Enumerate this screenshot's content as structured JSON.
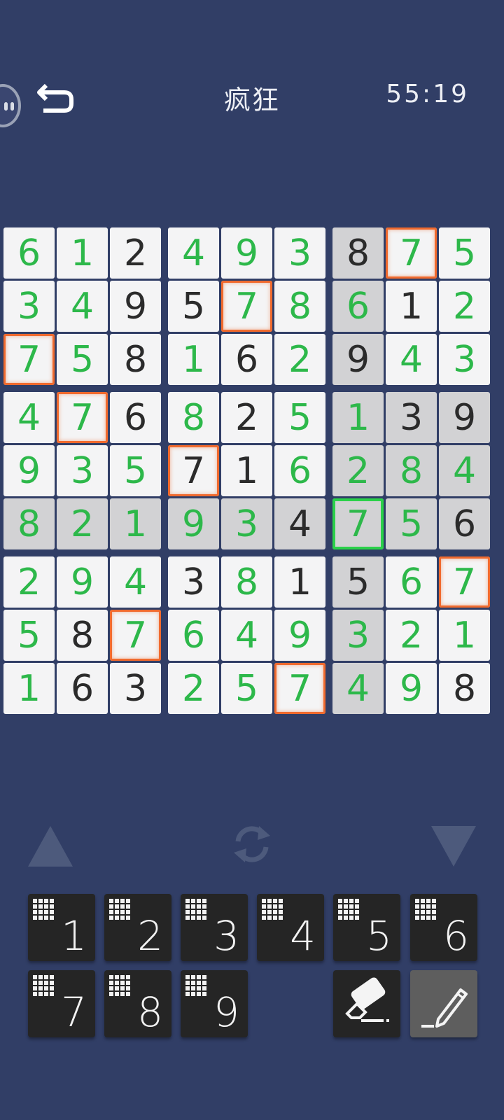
{
  "header": {
    "title": "疯狂",
    "timer": "55:19"
  },
  "board": {
    "rows": [
      [
        "6",
        "1",
        "2",
        "4",
        "9",
        "3",
        "8",
        "7",
        "5"
      ],
      [
        "3",
        "4",
        "9",
        "5",
        "7",
        "8",
        "6",
        "1",
        "2"
      ],
      [
        "7",
        "5",
        "8",
        "1",
        "6",
        "2",
        "9",
        "4",
        "3"
      ],
      [
        "4",
        "7",
        "6",
        "8",
        "2",
        "5",
        "1",
        "3",
        "9"
      ],
      [
        "9",
        "3",
        "5",
        "7",
        "1",
        "6",
        "2",
        "8",
        "4"
      ],
      [
        "8",
        "2",
        "1",
        "9",
        "3",
        "4",
        "7",
        "5",
        "6"
      ],
      [
        "2",
        "9",
        "4",
        "3",
        "8",
        "1",
        "5",
        "6",
        "7"
      ],
      [
        "5",
        "8",
        "7",
        "6",
        "4",
        "9",
        "3",
        "2",
        "1"
      ],
      [
        "1",
        "6",
        "3",
        "2",
        "5",
        "7",
        "4",
        "9",
        "8"
      ]
    ],
    "green": [
      [
        1,
        1,
        0,
        1,
        1,
        1,
        0,
        1,
        1
      ],
      [
        1,
        1,
        0,
        0,
        1,
        1,
        1,
        0,
        1
      ],
      [
        1,
        1,
        0,
        1,
        0,
        1,
        0,
        1,
        1
      ],
      [
        1,
        1,
        0,
        1,
        0,
        1,
        1,
        0,
        0
      ],
      [
        1,
        1,
        1,
        0,
        0,
        1,
        1,
        1,
        1
      ],
      [
        1,
        1,
        1,
        1,
        1,
        0,
        1,
        1,
        0
      ],
      [
        1,
        1,
        1,
        0,
        1,
        0,
        0,
        1,
        1
      ],
      [
        1,
        0,
        1,
        1,
        1,
        1,
        1,
        1,
        1
      ],
      [
        1,
        0,
        0,
        1,
        1,
        1,
        1,
        1,
        0
      ]
    ],
    "shaded": [
      [
        0,
        0,
        0,
        0,
        0,
        0,
        1,
        0,
        0
      ],
      [
        0,
        0,
        0,
        0,
        0,
        0,
        1,
        0,
        0
      ],
      [
        0,
        0,
        0,
        0,
        0,
        0,
        1,
        0,
        0
      ],
      [
        0,
        0,
        0,
        0,
        0,
        0,
        1,
        1,
        1
      ],
      [
        0,
        0,
        0,
        0,
        0,
        0,
        1,
        1,
        1
      ],
      [
        1,
        1,
        1,
        1,
        1,
        1,
        1,
        1,
        1
      ],
      [
        0,
        0,
        0,
        0,
        0,
        0,
        1,
        0,
        0
      ],
      [
        0,
        0,
        0,
        0,
        0,
        0,
        1,
        0,
        0
      ],
      [
        0,
        0,
        0,
        0,
        0,
        0,
        1,
        0,
        0
      ]
    ],
    "conflict_cells": [
      [
        0,
        7
      ],
      [
        1,
        4
      ],
      [
        2,
        0
      ],
      [
        3,
        1
      ],
      [
        4,
        3
      ],
      [
        6,
        8
      ],
      [
        7,
        2
      ],
      [
        8,
        5
      ]
    ],
    "selected_cell": [
      5,
      6
    ],
    "colors": {
      "given": "#2b2b2b",
      "entered": "#2db84a",
      "conflict": "#f06a2e",
      "selected": "#2bd14a"
    }
  },
  "controls": {
    "icons": [
      "up-arrow-icon",
      "sync-icon",
      "down-arrow-icon"
    ]
  },
  "keypad": {
    "numbers": [
      "1",
      "2",
      "3",
      "4",
      "5",
      "6",
      "7",
      "8",
      "9"
    ],
    "tools": [
      "eraser-icon",
      "pencil-icon"
    ]
  }
}
